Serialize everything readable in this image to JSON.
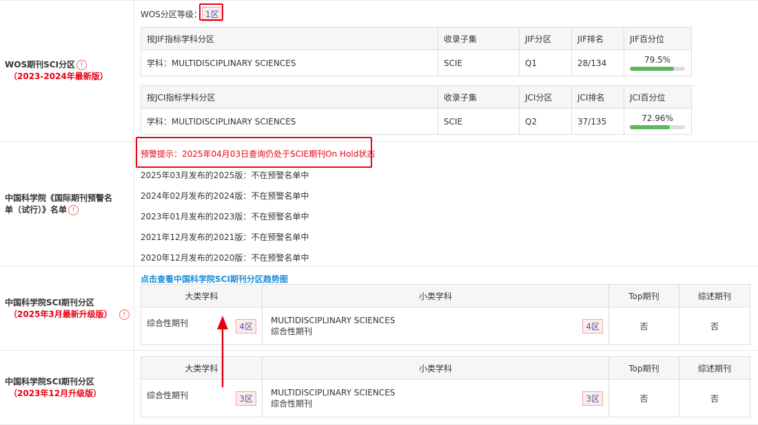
{
  "wos": {
    "label": "WOS期刊SCI分区",
    "sub": "（2023-2024年最新版）",
    "level_label": "WOS分区等级：",
    "level_value": "1区",
    "jif_table": {
      "headers": [
        "按JIF指标学科分区",
        "收录子集",
        "JIF分区",
        "JIF排名",
        "JIF百分位"
      ],
      "row": {
        "subject": "学科：MULTIDISCIPLINARY SCIENCES",
        "subset": "SCIE",
        "quartile": "Q1",
        "rank": "28/134",
        "percentile": "79.5%",
        "percentile_value": 79.5
      }
    },
    "jci_table": {
      "headers": [
        "按JCI指标学科分区",
        "收录子集",
        "JCI分区",
        "JCI排名",
        "JCI百分位"
      ],
      "row": {
        "subject": "学科：MULTIDISCIPLINARY SCIENCES",
        "subset": "SCIE",
        "quartile": "Q2",
        "rank": "37/135",
        "percentile": "72.96%",
        "percentile_value": 72.96
      }
    }
  },
  "warning": {
    "label": "中国科学院《国际期刊预警名单（试行）》名单",
    "alert": "预警提示：2025年04月03日查询仍处于SCIE期刊On Hold状态",
    "lines": [
      "2025年03月发布的2025版：不在预警名单中",
      "2024年02月发布的2024版：不在预警名单中",
      "2023年01月发布的2023版：不在预警名单中",
      "2021年12月发布的2021版：不在预警名单中",
      "2020年12月发布的2020版：不在预警名单中"
    ]
  },
  "cas2025": {
    "label": "中国科学院SCI期刊分区",
    "sub": "（2025年3月最新升级版）",
    "link": "点击查看中国科学院SCI期刊分区趋势图",
    "headers": [
      "大类学科",
      "小类学科",
      "Top期刊",
      "综述期刊"
    ],
    "major": "综合性期刊",
    "major_zone": "4区",
    "minor_en": "MULTIDISCIPLINARY SCIENCES",
    "minor_cn": "综合性期刊",
    "minor_zone": "4区",
    "top": "否",
    "review": "否"
  },
  "cas2023": {
    "label": "中国科学院SCI期刊分区",
    "sub": "（2023年12月升级版）",
    "headers": [
      "大类学科",
      "小类学科",
      "Top期刊",
      "综述期刊"
    ],
    "major": "综合性期刊",
    "major_zone": "3区",
    "minor_en": "MULTIDISCIPLINARY SCIENCES",
    "minor_cn": "综合性期刊",
    "minor_zone": "3区",
    "top": "否",
    "review": "否"
  },
  "colors": {
    "alert_red": "#e60012",
    "link_blue": "#1a8cd8",
    "bar_green": "#5cb85c"
  },
  "icons": [
    "info-icon",
    "arrow-up-icon"
  ]
}
